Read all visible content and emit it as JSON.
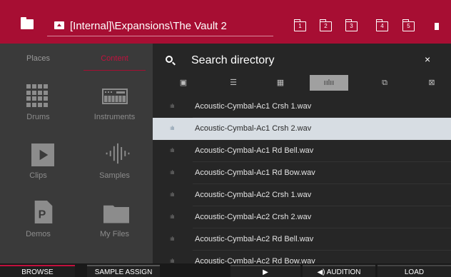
{
  "header": {
    "path": "[Internal]\\Expansions\\The Vault 2",
    "slots": [
      "1",
      "2",
      "3",
      "4",
      "5"
    ]
  },
  "sidebar": {
    "tabs": {
      "places": "Places",
      "content": "Content"
    },
    "tiles": [
      {
        "label": "Drums",
        "icon": "grid-pads-icon"
      },
      {
        "label": "Instruments",
        "icon": "keyboard-icon"
      },
      {
        "label": "Clips",
        "icon": "clip-play-icon"
      },
      {
        "label": "Samples",
        "icon": "waveform-icon"
      },
      {
        "label": "Demos",
        "icon": "demo-file-icon"
      },
      {
        "label": "My Files",
        "icon": "folder-icon"
      }
    ]
  },
  "search": {
    "placeholder": "Search directory",
    "close": "×"
  },
  "filters": [
    {
      "icon": "project-file-icon",
      "glyph": "▣",
      "active": false
    },
    {
      "icon": "sequence-icon",
      "glyph": "☰",
      "active": false
    },
    {
      "icon": "pads-icon",
      "glyph": "▦",
      "active": false
    },
    {
      "icon": "waveform-icon",
      "glyph": "ıılıı",
      "active": true
    },
    {
      "icon": "copy-icon",
      "glyph": "⧉",
      "active": false
    },
    {
      "icon": "no-filter-icon",
      "glyph": "⊠",
      "active": false
    }
  ],
  "files": [
    {
      "name": "Acoustic-Cymbal-Ac1 Crsh 1.wav",
      "selected": false
    },
    {
      "name": "Acoustic-Cymbal-Ac1 Crsh 2.wav",
      "selected": true
    },
    {
      "name": "Acoustic-Cymbal-Ac1 Rd Bell.wav",
      "selected": false
    },
    {
      "name": "Acoustic-Cymbal-Ac1 Rd Bow.wav",
      "selected": false
    },
    {
      "name": "Acoustic-Cymbal-Ac2 Crsh 1.wav",
      "selected": false
    },
    {
      "name": "Acoustic-Cymbal-Ac2 Crsh 2.wav",
      "selected": false
    },
    {
      "name": "Acoustic-Cymbal-Ac2 Rd Bell.wav",
      "selected": false
    },
    {
      "name": "Acoustic-Cymbal-Ac2 Rd Bow.wav",
      "selected": false
    }
  ],
  "bottom": {
    "browse": "BROWSE",
    "sample_assign": "SAMPLE ASSIGN",
    "play": "▶",
    "audition": "◀) AUDITION",
    "load": "LOAD"
  },
  "colors": {
    "accent": "#a70e33",
    "selected_row": "#d7dde3"
  }
}
